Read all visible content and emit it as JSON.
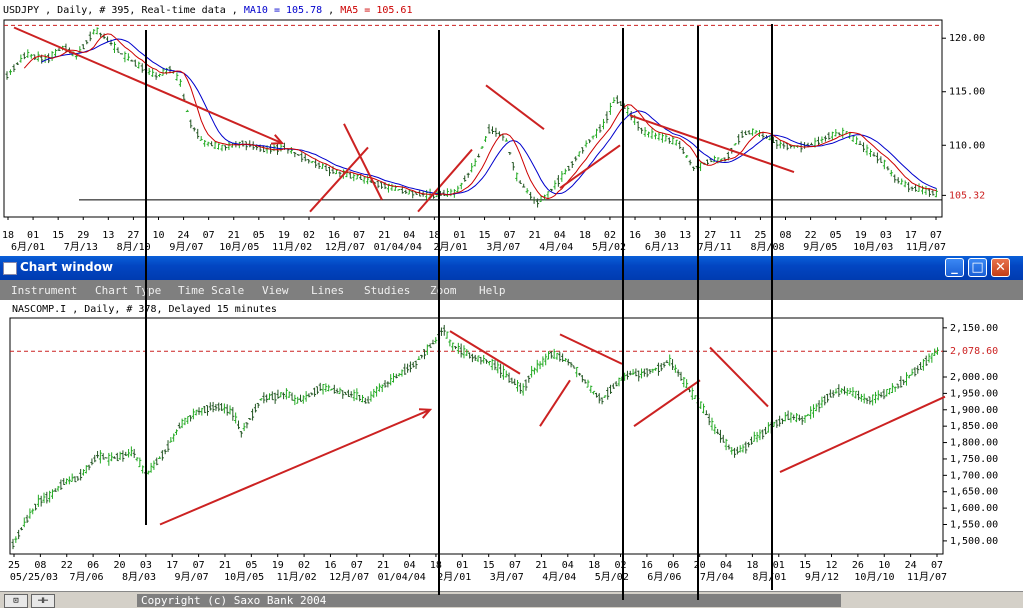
{
  "top_chart": {
    "header": {
      "instrument": "USDJPY , Daily, # 395, Real-time data ,",
      "ma10_label": "MA10 = 105.78",
      "sep": ",",
      "ma5_label": "MA5 = 105.61"
    },
    "colors": {
      "ma10": "#0000cc",
      "ma5": "#cc0000",
      "bars": "#22aa22",
      "annot": "#cc2222"
    }
  },
  "window": {
    "title": "Chart window",
    "buttons": {
      "minimize": "_",
      "maximize": "□",
      "close": "✕"
    },
    "menu": [
      "Instrument",
      "Chart Type",
      "Time Scale",
      "View",
      "Lines",
      "Studies",
      "Zoom",
      "Help"
    ]
  },
  "bottom_chart": {
    "header": "NASCOMP.I , Daily, # 378, Delayed 15 minutes"
  },
  "status": {
    "btn1": "⊡",
    "btn2": "⊣⊢",
    "copyright": "Copyright (c) Saxo Bank 2004"
  },
  "chart_data": [
    {
      "type": "candlestick",
      "instrument": "USDJPY",
      "y_ticks": [
        "120.00",
        "115.00",
        "110.00",
        "105.32"
      ],
      "last_price_label": "105.32",
      "ylim": [
        103.3,
        121.7
      ],
      "x_tick_days": [
        "18",
        "01",
        "15",
        "29",
        "13",
        "27",
        "10",
        "24",
        "07",
        "21",
        "05",
        "19",
        "02",
        "16",
        "07",
        "21",
        "04",
        "18",
        "01",
        "15",
        "07",
        "21",
        "04",
        "18",
        "02",
        "16",
        "30",
        "13",
        "27",
        "11",
        "25",
        "08",
        "22",
        "05",
        "19",
        "03",
        "17",
        "07"
      ],
      "x_tick_dates": [
        "6月/01",
        "7月/13",
        "8月/10",
        "9月/07",
        "10月/05",
        "11月/02",
        "12月/07",
        "01/04/04",
        "2月/01",
        "3月/07",
        "4月/04",
        "5月/02",
        "6月/13",
        "7月/11",
        "8月/08",
        "9月/05",
        "10月/03",
        "11月/07"
      ],
      "reference_line": 121.2,
      "horizontal_line": 104.9,
      "path_points": [
        [
          0,
          116.5
        ],
        [
          12,
          118.5
        ],
        [
          25,
          118.0
        ],
        [
          36,
          119.2
        ],
        [
          44,
          118.3
        ],
        [
          56,
          120.8
        ],
        [
          64,
          119.8
        ],
        [
          72,
          118.6
        ],
        [
          84,
          117.4
        ],
        [
          95,
          116.4
        ],
        [
          104,
          117.2
        ],
        [
          110,
          115.8
        ],
        [
          116,
          112.2
        ],
        [
          124,
          110.3
        ],
        [
          136,
          109.8
        ],
        [
          150,
          110.2
        ],
        [
          164,
          109.6
        ],
        [
          176,
          109.8
        ],
        [
          190,
          108.7
        ],
        [
          206,
          107.6
        ],
        [
          222,
          107.0
        ],
        [
          238,
          106.3
        ],
        [
          254,
          105.6
        ],
        [
          270,
          105.3
        ],
        [
          285,
          105.6
        ],
        [
          298,
          108.5
        ],
        [
          306,
          111.5
        ],
        [
          316,
          110.8
        ],
        [
          324,
          106.8
        ],
        [
          336,
          104.6
        ],
        [
          344,
          105.6
        ],
        [
          356,
          107.8
        ],
        [
          368,
          110.2
        ],
        [
          378,
          111.8
        ],
        [
          386,
          114.4
        ],
        [
          394,
          113.2
        ],
        [
          404,
          111.2
        ],
        [
          414,
          110.8
        ],
        [
          426,
          110.2
        ],
        [
          436,
          107.8
        ],
        [
          446,
          108.6
        ],
        [
          456,
          108.7
        ],
        [
          466,
          111.0
        ],
        [
          474,
          111.3
        ],
        [
          482,
          110.7
        ],
        [
          492,
          110.0
        ],
        [
          502,
          109.9
        ],
        [
          512,
          110.1
        ],
        [
          522,
          110.9
        ],
        [
          532,
          111.2
        ],
        [
          546,
          109.5
        ],
        [
          556,
          108.4
        ],
        [
          564,
          106.8
        ],
        [
          574,
          106.0
        ],
        [
          582,
          105.8
        ],
        [
          590,
          105.4
        ]
      ],
      "ma_offsets": {
        "MA10": 0.7,
        "MA5": 0.3
      },
      "annotations": [
        {
          "kind": "arrow",
          "from": [
            10,
            121.0
          ],
          "to": [
            278,
            110.2
          ]
        },
        {
          "kind": "trend",
          "from": [
            306,
            103.8
          ],
          "to": [
            364,
            109.8
          ]
        },
        {
          "kind": "trend",
          "from": [
            340,
            112.0
          ],
          "to": [
            378,
            104.9
          ]
        },
        {
          "kind": "trend",
          "from": [
            414,
            103.8
          ],
          "to": [
            468,
            109.6
          ]
        },
        {
          "kind": "trend",
          "from": [
            482,
            115.6
          ],
          "to": [
            540,
            111.5
          ]
        },
        {
          "kind": "trend",
          "from": [
            556,
            106.0
          ],
          "to": [
            616,
            110.0
          ]
        },
        {
          "kind": "trend",
          "from": [
            626,
            112.8
          ],
          "to": [
            790,
            107.5
          ]
        }
      ]
    },
    {
      "type": "candlestick",
      "instrument": "NASCOMP.I",
      "y_ticks": [
        "2,150.00",
        "2,078.60",
        "2,000.00",
        "1,950.00",
        "1,900.00",
        "1,850.00",
        "1,800.00",
        "1,750.00",
        "1,700.00",
        "1,650.00",
        "1,600.00",
        "1,550.00",
        "1,500.00"
      ],
      "last_price_label": "2,078.60",
      "ylim": [
        1460,
        2180
      ],
      "reference_line": 2078.6,
      "x_tick_days": [
        "25",
        "08",
        "22",
        "06",
        "20",
        "03",
        "17",
        "07",
        "21",
        "05",
        "19",
        "02",
        "16",
        "07",
        "21",
        "04",
        "18",
        "01",
        "15",
        "07",
        "21",
        "04",
        "18",
        "02",
        "16",
        "06",
        "20",
        "04",
        "18",
        "01",
        "15",
        "12",
        "26",
        "10",
        "24",
        "07"
      ],
      "x_tick_dates": [
        "05/25/03",
        "7月/06",
        "8月/03",
        "9月/07",
        "10月/05",
        "11月/02",
        "12月/07",
        "01/04/04",
        "2月/01",
        "3月/07",
        "4月/04",
        "5月/02",
        "6月/06",
        "7月/04",
        "8月/01",
        "9月/12",
        "10月/10",
        "11月/07"
      ],
      "path_points": [
        [
          0,
          1490
        ],
        [
          10,
          1560
        ],
        [
          20,
          1620
        ],
        [
          30,
          1640
        ],
        [
          40,
          1680
        ],
        [
          50,
          1690
        ],
        [
          58,
          1720
        ],
        [
          66,
          1760
        ],
        [
          76,
          1750
        ],
        [
          86,
          1760
        ],
        [
          94,
          1770
        ],
        [
          104,
          1700
        ],
        [
          112,
          1740
        ],
        [
          120,
          1780
        ],
        [
          130,
          1850
        ],
        [
          142,
          1890
        ],
        [
          152,
          1905
        ],
        [
          162,
          1910
        ],
        [
          172,
          1890
        ],
        [
          178,
          1830
        ],
        [
          186,
          1880
        ],
        [
          194,
          1935
        ],
        [
          204,
          1940
        ],
        [
          214,
          1950
        ],
        [
          222,
          1925
        ],
        [
          230,
          1940
        ],
        [
          240,
          1970
        ],
        [
          250,
          1960
        ],
        [
          260,
          1950
        ],
        [
          270,
          1940
        ],
        [
          276,
          1920
        ],
        [
          284,
          1960
        ],
        [
          296,
          1990
        ],
        [
          306,
          2020
        ],
        [
          314,
          2040
        ],
        [
          322,
          2080
        ],
        [
          330,
          2110
        ],
        [
          336,
          2150
        ],
        [
          342,
          2100
        ],
        [
          350,
          2080
        ],
        [
          360,
          2060
        ],
        [
          370,
          2050
        ],
        [
          378,
          2030
        ],
        [
          386,
          2000
        ],
        [
          392,
          1980
        ],
        [
          398,
          1960
        ],
        [
          404,
          2010
        ],
        [
          412,
          2040
        ],
        [
          420,
          2070
        ],
        [
          428,
          2060
        ],
        [
          436,
          2040
        ],
        [
          446,
          1990
        ],
        [
          454,
          1950
        ],
        [
          460,
          1930
        ],
        [
          466,
          1960
        ],
        [
          474,
          1990
        ],
        [
          482,
          2010
        ],
        [
          490,
          2010
        ],
        [
          498,
          2020
        ],
        [
          506,
          2030
        ],
        [
          512,
          2050
        ],
        [
          520,
          2010
        ],
        [
          528,
          1960
        ],
        [
          536,
          1920
        ],
        [
          542,
          1880
        ],
        [
          548,
          1840
        ],
        [
          556,
          1800
        ],
        [
          562,
          1770
        ],
        [
          570,
          1780
        ],
        [
          578,
          1810
        ],
        [
          586,
          1830
        ],
        [
          596,
          1860
        ],
        [
          606,
          1880
        ],
        [
          616,
          1870
        ],
        [
          626,
          1900
        ],
        [
          636,
          1940
        ],
        [
          646,
          1960
        ],
        [
          656,
          1950
        ],
        [
          666,
          1930
        ],
        [
          676,
          1940
        ],
        [
          686,
          1960
        ],
        [
          696,
          1990
        ],
        [
          708,
          2030
        ],
        [
          716,
          2060
        ],
        [
          722,
          2078
        ]
      ],
      "annotations": [
        {
          "kind": "arrow",
          "from": [
            150,
            1550
          ],
          "to": [
            420,
            1900
          ]
        },
        {
          "kind": "trend",
          "from": [
            440,
            2140
          ],
          "to": [
            510,
            2010
          ]
        },
        {
          "kind": "trend",
          "from": [
            530,
            1850
          ],
          "to": [
            560,
            1990
          ]
        },
        {
          "kind": "trend",
          "from": [
            550,
            2130
          ],
          "to": [
            612,
            2040
          ]
        },
        {
          "kind": "trend",
          "from": [
            624,
            1850
          ],
          "to": [
            690,
            1990
          ]
        },
        {
          "kind": "trend",
          "from": [
            700,
            2090
          ],
          "to": [
            758,
            1910
          ]
        },
        {
          "kind": "trend",
          "from": [
            770,
            1710
          ],
          "to": [
            935,
            1940
          ]
        }
      ]
    }
  ]
}
